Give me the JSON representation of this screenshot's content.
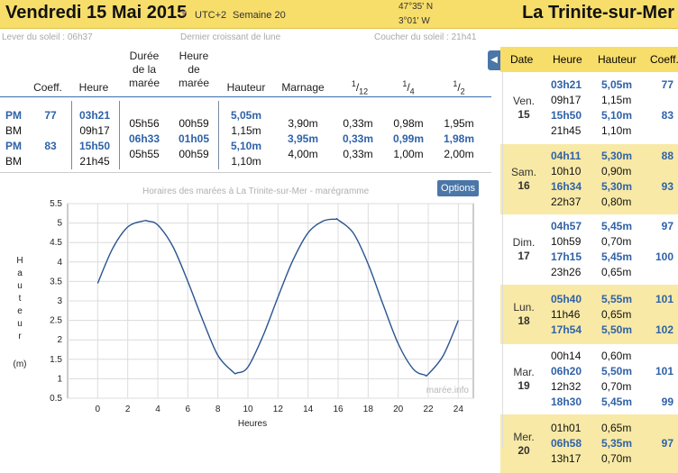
{
  "header": {
    "date": "Vendredi 15 Mai 2015",
    "utc": "UTC+2",
    "week": "Semaine 20",
    "lat": "47°35' N",
    "lon": "3°01' W",
    "place": "La Trinite-sur-Mer"
  },
  "sun": {
    "sunrise": "Lever du soleil : 06h37",
    "moon": "Dernier croissant de lune",
    "sunset": "Coucher du soleil : 21h41"
  },
  "table": {
    "headers": {
      "coeff": "Coeff.",
      "heure": "Heure",
      "duree": [
        "Durée",
        "de la",
        "marée"
      ],
      "heure_maree": [
        "Heure",
        "de",
        "marée"
      ],
      "hauteur": "Hauteur",
      "marnage": "Marnage",
      "f12_num": "1",
      "f12_den": "12",
      "f4_num": "1",
      "f4_den": "4",
      "f2_num": "1",
      "f2_den": "2"
    },
    "rows": [
      {
        "type": "PM",
        "coeff": "77",
        "heure": "03h21",
        "duree": "",
        "heure_maree": "",
        "hauteur": "5,05m",
        "marnage": "",
        "f12": "",
        "f4": "",
        "f2": ""
      },
      {
        "type": "BM",
        "coeff": "",
        "heure": "09h17",
        "duree": "05h56",
        "heure_maree": "00h59",
        "hauteur": "1,15m",
        "marnage": "3,90m",
        "f12": "0,33m",
        "f4": "0,98m",
        "f2": "1,95m"
      },
      {
        "type": "PM",
        "coeff": "83",
        "heure": "15h50",
        "duree": "06h33",
        "heure_maree": "01h05",
        "hauteur": "5,10m",
        "marnage": "3,95m",
        "f12": "0,33m",
        "f4": "0,99m",
        "f2": "1,98m"
      },
      {
        "type": "BM",
        "coeff": "",
        "heure": "21h45",
        "duree": "05h55",
        "heure_maree": "00h59",
        "hauteur": "1,10m",
        "marnage": "4,00m",
        "f12": "0,33m",
        "f4": "1,00m",
        "f2": "2,00m"
      }
    ]
  },
  "chart_title": "Horaires des marées à La Trinite-sur-Mer - marégramme",
  "options_label": "Options",
  "chart_data": {
    "type": "line",
    "ylabel": "Hauteur (m)",
    "xlabel": "Heures",
    "xlim": [
      -2,
      25
    ],
    "ylim": [
      0.5,
      5.5
    ],
    "xticks": [
      0,
      2,
      4,
      6,
      8,
      10,
      12,
      14,
      16,
      18,
      20,
      22,
      24
    ],
    "yticks": [
      0.5,
      1,
      1.5,
      2,
      2.5,
      3,
      3.5,
      4,
      4.5,
      5,
      5.5
    ],
    "grid": true,
    "watermark": "marée.info",
    "x": [
      0,
      1,
      2,
      3,
      3.35,
      4,
      5,
      6,
      7,
      8,
      9,
      9.28,
      10,
      11,
      12,
      13,
      14,
      15,
      15.83,
      16,
      17,
      18,
      19,
      20,
      21,
      21.75,
      22,
      23,
      24
    ],
    "y": [
      3.45,
      4.35,
      4.9,
      5.05,
      5.05,
      4.95,
      4.4,
      3.5,
      2.5,
      1.6,
      1.18,
      1.15,
      1.3,
      2.1,
      3.1,
      4.05,
      4.75,
      5.05,
      5.1,
      5.08,
      4.75,
      3.95,
      2.9,
      1.9,
      1.25,
      1.1,
      1.12,
      1.6,
      2.5
    ]
  },
  "side": {
    "headers": {
      "date": "Date",
      "heure": "Heure",
      "hauteur": "Hauteur",
      "coeff": "Coeff."
    },
    "days": [
      {
        "name": "Ven.",
        "num": "15",
        "bg": "#ffffff",
        "rows": [
          {
            "h": "03h21",
            "m": "5,05m",
            "c": "77",
            "hi": true
          },
          {
            "h": "09h17",
            "m": "1,15m",
            "c": "",
            "hi": false
          },
          {
            "h": "15h50",
            "m": "5,10m",
            "c": "83",
            "hi": true
          },
          {
            "h": "21h45",
            "m": "1,10m",
            "c": "",
            "hi": false
          }
        ]
      },
      {
        "name": "Sam.",
        "num": "16",
        "bg": "#f8e9a6",
        "rows": [
          {
            "h": "04h11",
            "m": "5,30m",
            "c": "88",
            "hi": true
          },
          {
            "h": "10h10",
            "m": "0,90m",
            "c": "",
            "hi": false
          },
          {
            "h": "16h34",
            "m": "5,30m",
            "c": "93",
            "hi": true
          },
          {
            "h": "22h37",
            "m": "0,80m",
            "c": "",
            "hi": false
          }
        ]
      },
      {
        "name": "Dim.",
        "num": "17",
        "bg": "#ffffff",
        "rows": [
          {
            "h": "04h57",
            "m": "5,45m",
            "c": "97",
            "hi": true
          },
          {
            "h": "10h59",
            "m": "0,70m",
            "c": "",
            "hi": false
          },
          {
            "h": "17h15",
            "m": "5,45m",
            "c": "100",
            "hi": true
          },
          {
            "h": "23h26",
            "m": "0,65m",
            "c": "",
            "hi": false
          }
        ]
      },
      {
        "name": "Lun.",
        "num": "18",
        "bg": "#f8e9a6",
        "rows": [
          {
            "h": "05h40",
            "m": "5,55m",
            "c": "101",
            "hi": true
          },
          {
            "h": "11h46",
            "m": "0,65m",
            "c": "",
            "hi": false
          },
          {
            "h": "17h54",
            "m": "5,50m",
            "c": "102",
            "hi": true
          }
        ]
      },
      {
        "name": "Mar.",
        "num": "19",
        "bg": "#ffffff",
        "rows": [
          {
            "h": "00h14",
            "m": "0,60m",
            "c": "",
            "hi": false
          },
          {
            "h": "06h20",
            "m": "5,50m",
            "c": "101",
            "hi": true
          },
          {
            "h": "12h32",
            "m": "0,70m",
            "c": "",
            "hi": false
          },
          {
            "h": "18h30",
            "m": "5,45m",
            "c": "99",
            "hi": true
          }
        ]
      },
      {
        "name": "Mer.",
        "num": "20",
        "bg": "#f8e9a6",
        "rows": [
          {
            "h": "01h01",
            "m": "0,65m",
            "c": "",
            "hi": false
          },
          {
            "h": "06h58",
            "m": "5,35m",
            "c": "97",
            "hi": true
          },
          {
            "h": "13h17",
            "m": "0,70m",
            "c": "",
            "hi": false
          }
        ]
      }
    ]
  }
}
